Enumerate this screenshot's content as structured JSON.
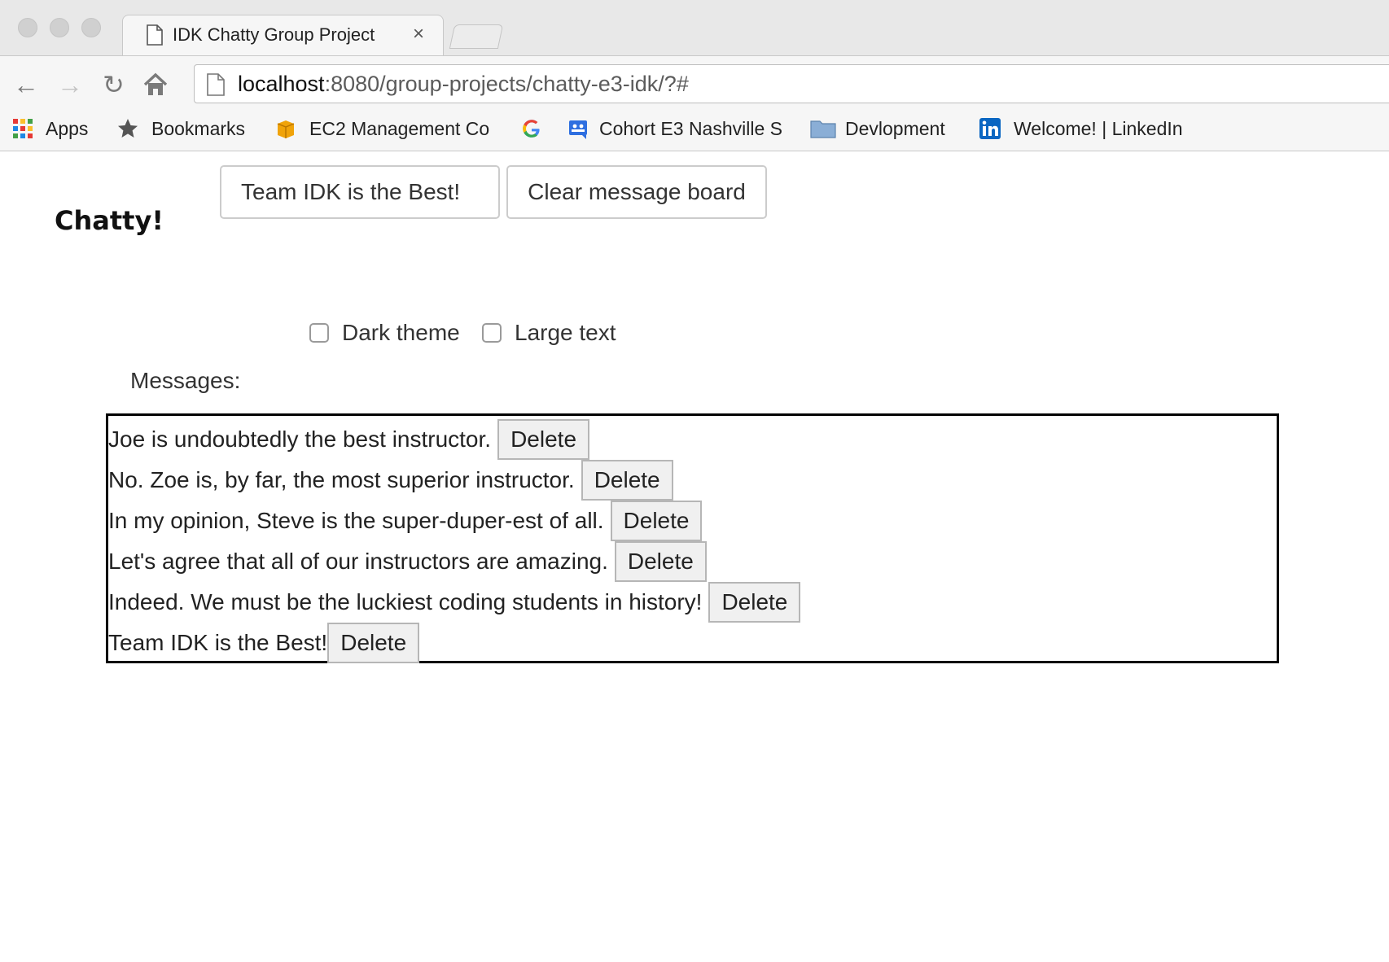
{
  "browser": {
    "tab_title": "IDK Chatty Group Project",
    "tab_close": "×",
    "url_host": "localhost",
    "url_path": ":8080/group-projects/chatty-e3-idk/?#",
    "bookmarks": [
      {
        "label": "Apps",
        "icon": "apps-grid-icon"
      },
      {
        "label": "Bookmarks",
        "icon": "star-icon"
      },
      {
        "label": "EC2 Management Co",
        "icon": "aws-box-icon"
      },
      {
        "label": "",
        "icon": "google-icon"
      },
      {
        "label": "Cohort E3 Nashville S",
        "icon": "classroom-icon"
      },
      {
        "label": "Devlopment",
        "icon": "folder-icon"
      },
      {
        "label": "Welcome! | LinkedIn",
        "icon": "linkedin-icon"
      }
    ]
  },
  "page": {
    "logo": "Chatty!",
    "message_input_value": "Team IDK is the Best!",
    "clear_button": "Clear message board",
    "dark_theme_label": "Dark theme",
    "large_text_label": "Large text",
    "dark_theme_checked": false,
    "large_text_checked": false,
    "messages_label": "Messages:",
    "delete_label": "Delete",
    "messages": [
      "Joe is undoubtedly the best instructor.",
      "No. Zoe is, by far, the most superior instructor.",
      "In my opinion, Steve is the super-duper-est of all.",
      "Let's agree that all of our instructors are amazing.",
      "Indeed. We must be the luckiest coding students in history!",
      "Team IDK is the Best!"
    ]
  }
}
